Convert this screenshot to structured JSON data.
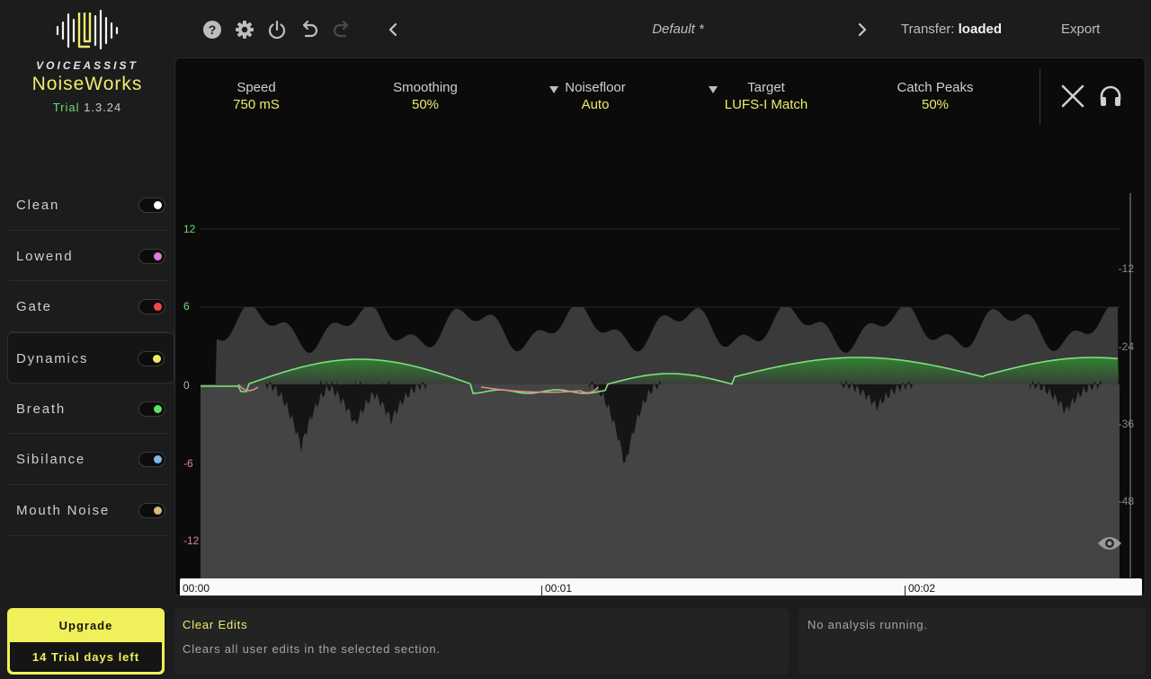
{
  "brand": {
    "top": "VOICEASSIST",
    "name": "NoiseWorks",
    "trial_label": "Trial",
    "version": "1.3.24"
  },
  "modules": [
    {
      "label": "Clean",
      "dot_color": "#ffffff",
      "active": false
    },
    {
      "label": "Lowend",
      "dot_color": "#e27ae2",
      "active": false
    },
    {
      "label": "Gate",
      "dot_color": "#f04848",
      "active": false
    },
    {
      "label": "Dynamics",
      "dot_color": "#ecec6a",
      "active": true
    },
    {
      "label": "Breath",
      "dot_color": "#5ede6a",
      "active": false
    },
    {
      "label": "Sibilance",
      "dot_color": "#7fb8e8",
      "active": false
    },
    {
      "label": "Mouth Noise",
      "dot_color": "#d8b880",
      "active": false
    }
  ],
  "upgrade": {
    "label": "Upgrade",
    "days_left": "14 Trial days left"
  },
  "toolbar": {
    "icons": [
      "help-icon",
      "gear-icon",
      "power-icon",
      "undo-icon",
      "redo-icon"
    ],
    "preset_name": "Default *",
    "transfer_label": "Transfer:",
    "transfer_value": "loaded",
    "export_label": "Export"
  },
  "params": [
    {
      "name": "Speed",
      "value": "750 mS",
      "dropdown": false
    },
    {
      "name": "Smoothing",
      "value": "50%",
      "dropdown": false
    },
    {
      "name": "Noisefloor",
      "value": "Auto",
      "dropdown": true
    },
    {
      "name": "Target",
      "value": "LUFS-I Match",
      "dropdown": true
    },
    {
      "name": "Catch Peaks",
      "value": "50%",
      "dropdown": false
    }
  ],
  "left_scale": [
    "12",
    "6",
    "0",
    "-6",
    "-12"
  ],
  "right_scale": [
    "-12",
    "-24",
    "-36",
    "-48"
  ],
  "timeline": [
    "00:00",
    "00:01",
    "00:02"
  ],
  "info": {
    "title": "Clear Edits",
    "description": "Clears all user edits in the selected section.",
    "status": "No analysis running."
  },
  "colors": {
    "accent": "#ecec6a",
    "gain_up": "#6fdc6f",
    "gain_down": "#e08a8a"
  }
}
